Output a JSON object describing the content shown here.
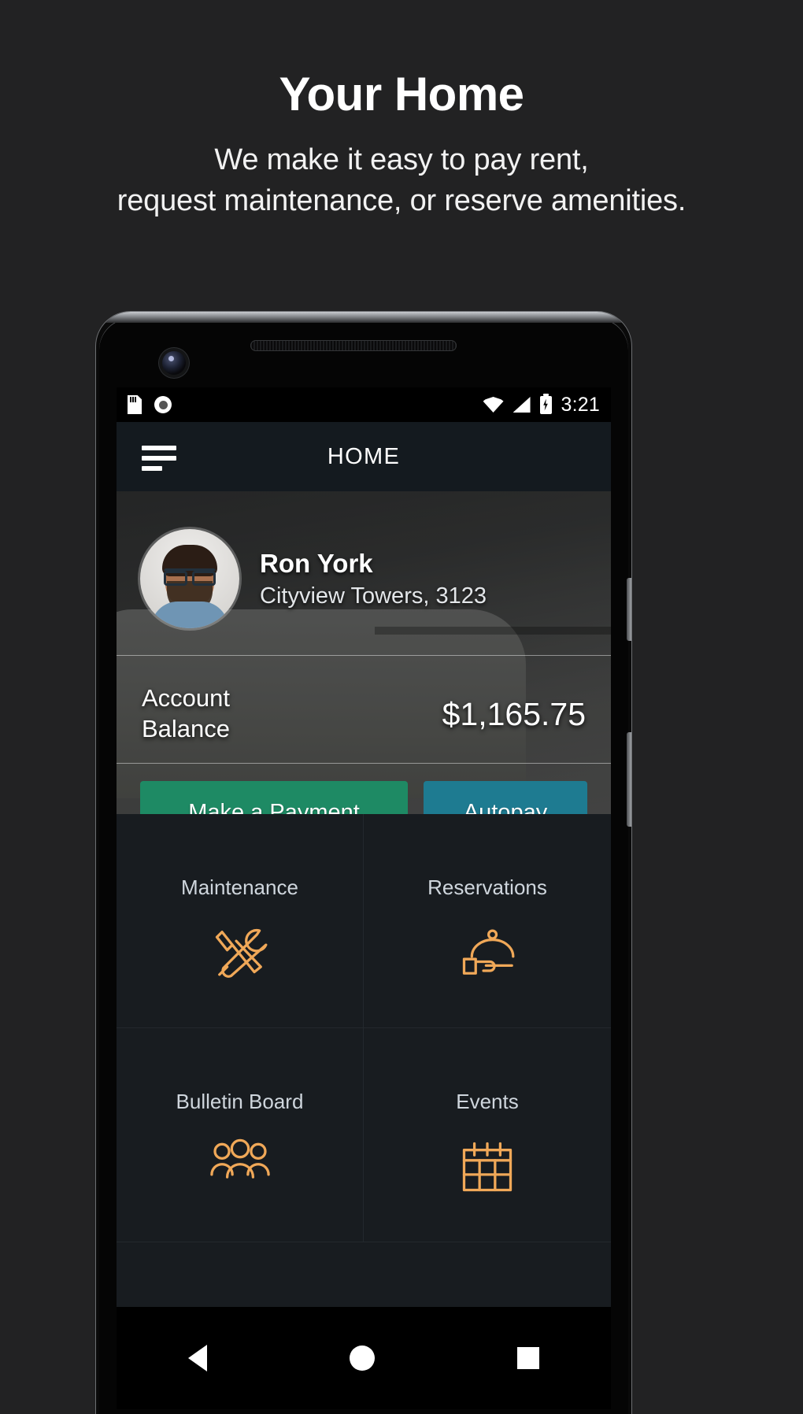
{
  "promo": {
    "title": "Your Home",
    "subtitle_line1": "We make it easy to pay rent,",
    "subtitle_line2": "request maintenance, or reserve amenities."
  },
  "phone": {
    "status_bar": {
      "time": "3:21",
      "icons_left": [
        "sd-card-icon",
        "screen-record-icon"
      ],
      "icons_right": [
        "wifi-icon",
        "cellular-signal-icon",
        "battery-charging-icon"
      ]
    },
    "nav_bar": {
      "back": "back-triangle-icon",
      "home": "home-circle-icon",
      "recents": "recents-square-icon"
    }
  },
  "app": {
    "appbar": {
      "menu_icon": "hamburger-menu-icon",
      "title": "HOME"
    },
    "profile": {
      "avatar": "user-avatar",
      "name": "Ron York",
      "address": "Cityview Towers, 3123"
    },
    "balance": {
      "label_line1": "Account",
      "label_line2": "Balance",
      "amount": "$1,165.75"
    },
    "actions": [
      {
        "label": "Make a Payment",
        "color": "#1e8a64"
      },
      {
        "label": "Autopay",
        "color": "#1e7b91"
      }
    ],
    "tiles": [
      {
        "label": "Maintenance",
        "icon": "tools-icon"
      },
      {
        "label": "Reservations",
        "icon": "room-service-icon"
      },
      {
        "label": "Bulletin Board",
        "icon": "people-icon"
      },
      {
        "label": "Events",
        "icon": "calendar-icon"
      }
    ],
    "colors": {
      "accent_orange": "#f0a858",
      "app_background": "#181c20",
      "appbar_background": "#141a1f",
      "page_background": "#222223"
    }
  }
}
